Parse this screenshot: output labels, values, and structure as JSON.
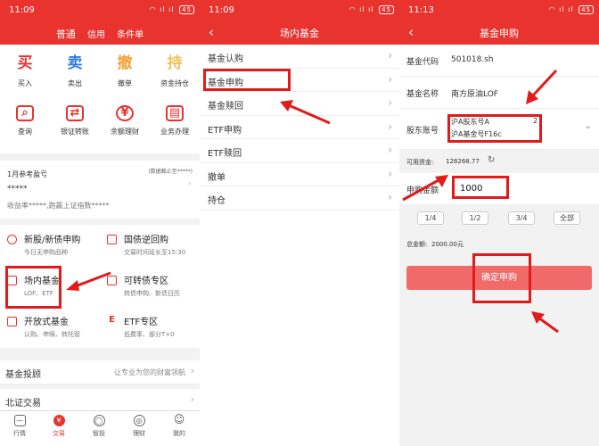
{
  "panel1": {
    "time": "11:09",
    "battery": "45",
    "tabs_top": [
      "普通",
      "信用",
      "条件单"
    ],
    "grid": [
      {
        "glyph": "买",
        "label": "买入",
        "color": "#e8332f"
      },
      {
        "glyph": "卖",
        "label": "卖出",
        "color": "#2f7de1"
      },
      {
        "glyph": "撤",
        "label": "撤单",
        "color": "#f0a23b"
      },
      {
        "glyph": "持",
        "label": "资金持仓",
        "color": "#f0c05a"
      },
      {
        "glyph": "⌕",
        "label": "查询",
        "color": "#e8332f"
      },
      {
        "glyph": "⇄",
        "label": "银证转账",
        "color": "#e8332f"
      },
      {
        "glyph": "¥",
        "label": "余额理财",
        "color": "#e8332f"
      },
      {
        "glyph": "▤",
        "label": "业务办理",
        "color": "#e8332f"
      }
    ],
    "account_label": "1月参考盈亏",
    "account_note": "(数据截止至*****)",
    "account_value": "*****",
    "account_sub": "收益率*****,跑赢上证指数*****",
    "rows": [
      {
        "title": "新股/新债申购",
        "sub": "今日无申购品种",
        "icon": "◎"
      },
      {
        "title": "国债逆回购",
        "sub": "交易时间延长至15:30",
        "icon": "▤"
      },
      {
        "title": "场内基金",
        "sub": "LOF、ETF",
        "icon": "▭"
      },
      {
        "title": "可转债专区",
        "sub": "转债申购、新债日历",
        "icon": "▤"
      },
      {
        "title": "开放式基金",
        "sub": "认购、申赎、转托管",
        "icon": "▥"
      },
      {
        "title": "ETF专区",
        "sub": "低费率、部分T+0",
        "icon": "E"
      }
    ],
    "list": [
      {
        "label": "基金投顾",
        "right": "让专业为您的财富领航"
      },
      {
        "label": "北证交易",
        "right": ""
      }
    ],
    "tabbar": [
      {
        "label": "行情",
        "icon": "—"
      },
      {
        "label": "交易",
        "icon": "¥"
      },
      {
        "label": "智投",
        "icon": "◯"
      },
      {
        "label": "理财",
        "icon": "◎"
      },
      {
        "label": "我的",
        "icon": "☺"
      }
    ]
  },
  "panel2": {
    "time": "11:09",
    "battery": "45",
    "title": "场内基金",
    "items": [
      "基金认购",
      "基金申购",
      "基金赎回",
      "ETF申购",
      "ETF赎回",
      "撤单",
      "持仓"
    ]
  },
  "panel3": {
    "time": "11:13",
    "battery": "45",
    "title": "基金申购",
    "code_label": "基金代码",
    "code_value": "501018.sh",
    "name_label": "基金名称",
    "name_value": "南方原油LOF",
    "account_label": "股东账号",
    "account_line1": "沪A股东号A",
    "account_line1_suffix": "2",
    "account_line2": "沪A基金号F16c",
    "funds_label": "可用资金:",
    "funds_value": "128268.77",
    "amount_label": "申购金额",
    "amount_value": "1000",
    "fractions": [
      "1/4",
      "1/2",
      "3/4",
      "全部"
    ],
    "total_label": "总金额:",
    "total_value": "2000.00元",
    "confirm": "确定申购"
  },
  "colors": {
    "brand": "#e8332f",
    "highlight": "#e21a1a",
    "confirm_btn": "#f06a6a"
  }
}
